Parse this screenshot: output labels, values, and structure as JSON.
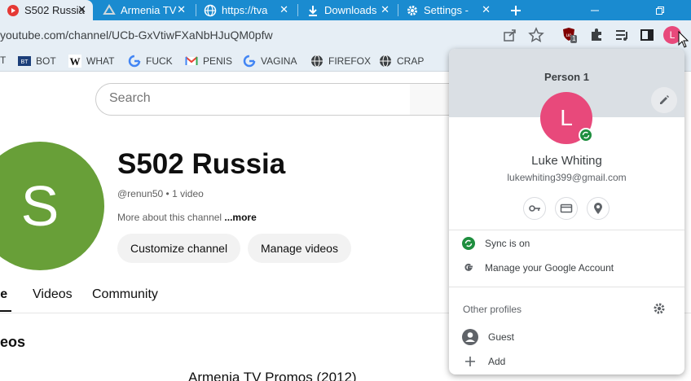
{
  "tabs": [
    {
      "title": "S502 Russia",
      "icon": "youtube-icon",
      "active": true
    },
    {
      "title": "Armenia TV",
      "icon": "drive-icon"
    },
    {
      "title": "https://tva",
      "icon": "globe-icon"
    },
    {
      "title": "Downloads",
      "icon": "download-icon"
    },
    {
      "title": "Settings -",
      "icon": "gear-icon"
    }
  ],
  "new_tab_icon": "plus-icon",
  "address": {
    "url": "youtube.com/channel/UCb-GxVtiwFXaNbHJuQM0pfw"
  },
  "extension_badge": "1",
  "bookmarks": [
    {
      "label": "T",
      "icon": ""
    },
    {
      "label": "BOT",
      "icon": "bt-icon"
    },
    {
      "label": "WHAT",
      "icon": "w-icon"
    },
    {
      "label": "FUCK",
      "icon": "google-icon"
    },
    {
      "label": "PENIS",
      "icon": "gmail-icon"
    },
    {
      "label": "VAGINA",
      "icon": "google-icon"
    },
    {
      "label": "FIREFOX",
      "icon": "globe-icon"
    },
    {
      "label": "CRAP",
      "icon": "globe-icon"
    }
  ],
  "youtube": {
    "search_placeholder": "Search",
    "avatar_letter": "S",
    "channel_name": "S502 Russia",
    "channel_meta": "@renun50 • 1 video",
    "about_text": "More about this channel ",
    "about_more": "...more",
    "buttons": {
      "customize": "Customize channel",
      "manage": "Manage videos"
    },
    "tabs": [
      "me",
      "Videos",
      "Community"
    ],
    "section_title": "eos",
    "video_title": "Armenia TV Promos (2012)"
  },
  "profile_popup": {
    "person_label": "Person 1",
    "avatar_letter": "L",
    "name": "Luke Whiting",
    "email": "lukewhiting399@gmail.com",
    "sync_label": "Sync is on",
    "manage_label": "Manage your Google Account",
    "other_profiles_label": "Other profiles",
    "guest_label": "Guest",
    "add_label": "Add"
  },
  "colors": {
    "tabstrip": "#1a8bd0",
    "avatar_channel": "#689f38",
    "avatar_profile": "#e8497b",
    "sync_green": "#1e8e3e"
  }
}
